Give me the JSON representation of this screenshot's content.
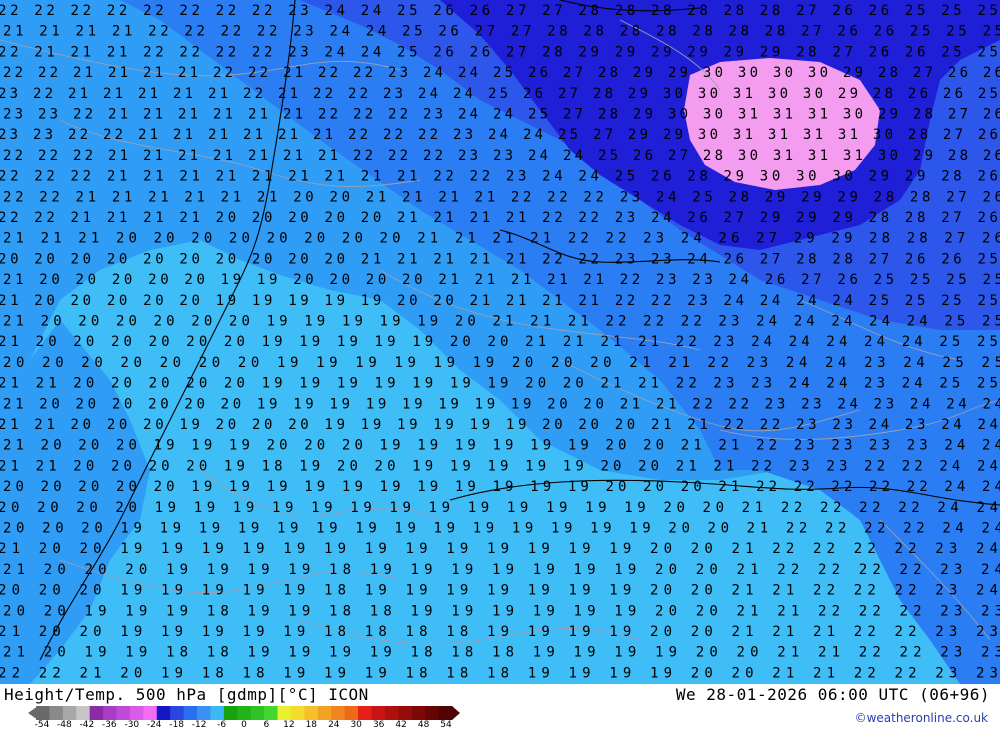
{
  "map": {
    "title": "Height/Temp. 500 hPa [gdmp][°C] ICON",
    "valid_time": "We 28-01-2026 06:00 UTC (06+96)",
    "copyright": "©weatheronline.co.uk",
    "colors": {
      "zone_18_19": "#3fbdf7",
      "zone_20_21": "#2f9cf5",
      "zone_22_23": "#2a7df2",
      "zone_24_26": "#2c57ea",
      "zone_27_29": "#1f1fd7",
      "zone_30_31": "#f49cf0",
      "contour_line": "#000000",
      "border_line": "#9aa0b8",
      "coast_line": "#000000"
    },
    "contour_rows": [
      {
        "row": 1,
        "text": "22 22 22 22 22 22 22 22 23 24 24 25 26 26 27 27 28 28 28 28 28 28 27 26 26 25 25 25"
      },
      {
        "row": 2,
        "text": "21 21 21 21 22 22 22 22 23 24 24 25 26 27 27 28 28 28 28 28 28 28 27 26 26 25 25 25"
      },
      {
        "row": 3,
        "text": "22 21 21 21 22 22 22 22 23 24 24 25 26 26 27 28 29 29 29 29 29 29 28 27 26 26 25 25"
      },
      {
        "row": 4,
        "text": "22 22 21 21 21 21 22 22 21 22 22 23 24 24 25 26 27 28 29 29 30 30 30 30 29 28 27 26 26"
      },
      {
        "row": 5,
        "text": "23 22 21 21 21 21 21 22 21 22 22 23 24 24 25 26 27 28 29 30 30 31 30 30 29 28 26 26 25"
      },
      {
        "row": 6,
        "text": "23 23 22 21 21 21 21 21 21 22 22 22 23 24 24 25 27 28 29 30 30 31 31 31 30 29 28 27 26"
      },
      {
        "row": 7,
        "text": "23 23 22 22 21 21 21 21 21 21 22 22 22 23 24 24 25 27 29 29 30 31 31 31 31 30 28 27 26"
      },
      {
        "row": 8,
        "text": "22 22 22 21 21 21 21 21 21 21 22 22 22 23 23 24 24 25 26 27 28 30 31 31 31 30 29 28 26"
      },
      {
        "row": 9,
        "text": "22 22 22 21 21 21 21 21 21 21 21 21 22 22 23 24 24 25 26 28 29 30 30 30 29 29 28 26"
      },
      {
        "row": 10,
        "text": "22 22 21 21 21 21 21 21 20 20 21 21 21 21 22 22 22 23 24 25 28 29 29 29 28 28 27 26"
      },
      {
        "row": 11,
        "text": "22 22 21 21 21 21 20 20 20 20 20 21 21 21 21 22 22 23 24 26 27 29 29 29 28 28 27 26"
      },
      {
        "row": 12,
        "text": "21 21 21 20 20 20 20 20 20 20 20 21 21 21 21 22 22 23 24 26 27 29 29 28 28 27 26"
      },
      {
        "row": 13,
        "text": "20 20 20 20 20 20 20 20 20 20 21 21 21 21 21 22 22 23 23 24 26 27 28 28 27 26 26 25"
      },
      {
        "row": 14,
        "text": "21 20 20 20 20 20 19 19 20 20 20 20 21 21 21 21 21 22 23 23 24 26 27 26 25 25 25 25"
      },
      {
        "row": 15,
        "text": "21 20 20 20 20 20 19 19 19 19 19 20 20 21 21 21 21 22 22 23 24 24 24 24 25 25 25 25"
      },
      {
        "row": 16,
        "text": "21 20 20 20 20 20 20 19 19 19 19 19 20 21 21 21 22 22 22 23 24 24 24 24 24 25 25"
      },
      {
        "row": 17,
        "text": "21 20 20 20 20 20 20 19 19 19 19 19 20 20 21 21 21 21 22 23 24 24 24 24 24 25 25"
      },
      {
        "row": 18,
        "text": "20 20 20 20 20 20 20 19 19 19 19 19 19 20 20 20 21 21 22 23 24 24 23 24 25 25"
      },
      {
        "row": 19,
        "text": "21 21 20 20 20 20 20 19 19 19 19 19 19 19 20 20 21 21 22 23 23 24 24 23 24 25 25"
      },
      {
        "row": 20,
        "text": "21 20 20 20 20 20 20 19 19 19 19 19 19 19 19 20 20 21 21 22 22 23 23 24 23 24 24 24"
      },
      {
        "row": 21,
        "text": "21 21 20 20 20 19 20 20 20 19 19 19 19 19 19 20 20 20 21 21 22 22 23 23 24 23 24 24"
      },
      {
        "row": 22,
        "text": "21 20 20 20 19 19 19 20 20 20 19 19 19 19 19 19 20 20 21 21 22 23 23 23 23 24 24"
      },
      {
        "row": 23,
        "text": "21 21 20 20 20 20 19 18 19 20 20 19 19 19 19 19 20 20 21 21 22 23 23 22 22 24 24"
      },
      {
        "row": 24,
        "text": "20 20 20 20 20 19 19 19 19 19 19 19 19 19 19 19 20 20 20 21 22 22 22 22 22 24 24"
      },
      {
        "row": 25,
        "text": "20 20 20 20 19 19 19 19 19 19 19 19 19 19 19 19 19 20 20 21 22 22 22 22 24 24"
      },
      {
        "row": 26,
        "text": "20 20 20 19 19 19 19 19 19 19 19 19 19 19 19 19 19 20 20 21 22 22 22 22 24 24"
      },
      {
        "row": 27,
        "text": "21 20 20 19 19 19 19 19 19 19 19 19 19 19 19 19 20 20 21 22 22 22 22 23 24"
      },
      {
        "row": 28,
        "text": "21 20 20 20 19 19 19 19 18 19 19 19 19 19 19 19 20 20 21 22 22 22 22 23 24"
      },
      {
        "row": 29,
        "text": "20 20 20 19 19 19 19 19 18 19 19 19 19 19 19 19 20 20 21 21 22 22 22 23 24"
      },
      {
        "row": 30,
        "text": "20 20 19 19 19 18 19 19 18 18 19 19 19 19 19 19 20 20 21 21 22 22 22 23 23"
      },
      {
        "row": 31,
        "text": "21 20 20 19 19 19 19 19 18 18 18 18 19 19 19 19 20 20 21 21 21 22 22 23 23"
      },
      {
        "row": 32,
        "text": "21 20 19 19 18 18 19 19 19 19 18 18 18 19 19 19 19 20 20 21 21 22 22 23 23"
      },
      {
        "row": 33,
        "text": "22 22 21 20 19 18 18 19 19 19 18 18 18 19 19 19 19 20 20 21 21 22 22 23 23"
      }
    ],
    "legend": {
      "colors": [
        "#6a6a6a",
        "#8a8a8a",
        "#a8a8a8",
        "#c6c6c6",
        "#8c2ca5",
        "#a83cc3",
        "#c04ad8",
        "#dc5ae8",
        "#f46cf4",
        "#1616c8",
        "#2a46e0",
        "#2c6ef0",
        "#3a90f2",
        "#3cb8f4",
        "#16a30e",
        "#21b416",
        "#2fc424",
        "#42d630",
        "#e8f030",
        "#f6da2e",
        "#f5c02a",
        "#f3a323",
        "#f1861e",
        "#ef6918",
        "#e52019",
        "#c81414",
        "#b00f0f",
        "#970b0b",
        "#7e0808",
        "#650505",
        "#4f0303"
      ],
      "ticks": [
        "-54",
        "-48",
        "-42",
        "-36",
        "-30",
        "-24",
        "-18",
        "-12",
        "-6",
        "0",
        "6",
        "12",
        "18",
        "24",
        "30",
        "36",
        "42",
        "48",
        "54"
      ]
    }
  }
}
